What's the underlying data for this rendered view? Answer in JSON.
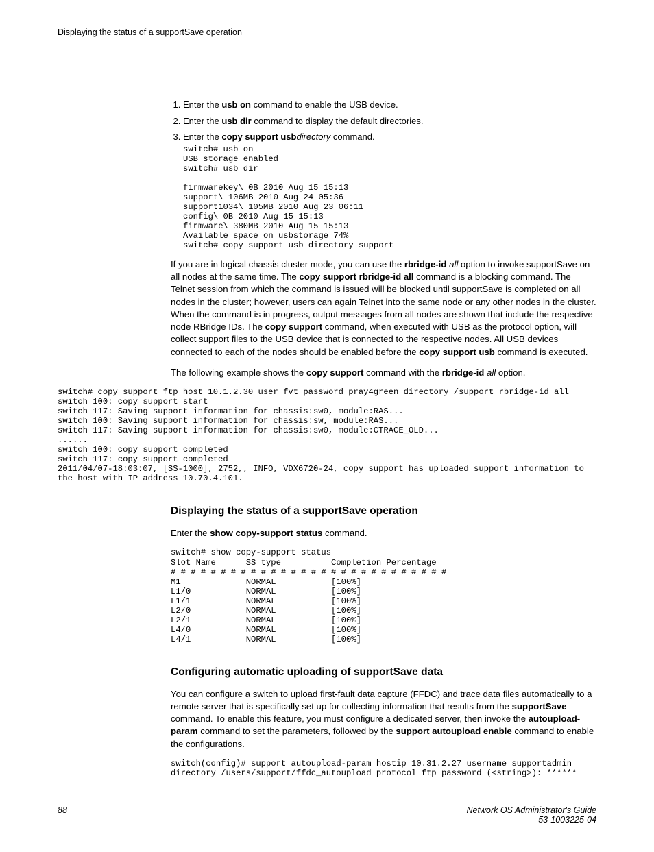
{
  "header": "Displaying the status of a supportSave operation",
  "steps": {
    "s1_pre": "Enter the ",
    "s1_cmd": "usb on",
    "s1_post": " command to enable the USB device.",
    "s2_pre": "Enter the ",
    "s2_cmd": "usb dir",
    "s2_post": " command to display the default directories.",
    "s3_pre": "Enter the ",
    "s3_cmd": "copy support usb",
    "s3_arg": "directory",
    "s3_post": " command."
  },
  "code1": "switch# usb on\nUSB storage enabled\nswitch# usb dir\n\nfirmwarekey\\ 0B 2010 Aug 15 15:13\nsupport\\ 106MB 2010 Aug 24 05:36\nsupport1034\\ 105MB 2010 Aug 23 06:11\nconfig\\ 0B 2010 Aug 15 15:13\nfirmware\\ 380MB 2010 Aug 15 15:13\nAvailable space on usbstorage 74%\nswitch# copy support usb directory support",
  "para1": {
    "p1": "If you are in logical chassis cluster mode, you can use the ",
    "b1": "rbridge-id",
    "i1": " all",
    "p2": " option to invoke supportSave on all nodes at the same time. The ",
    "b2": "copy support rbridge-id all",
    "p3": " command is a blocking command. The Telnet session from which the command is issued will be blocked until supportSave is completed on all nodes in the cluster; however, users can again Telnet into the same node or any other nodes in the cluster. When the command is in progress, output messages from all nodes are shown that include the respective node RBridge IDs. The ",
    "b3": "copy support",
    "p4": " command, when executed with USB as the protocol option, will collect support files to the USB device that is connected to the respective nodes. All USB devices connected to each of the nodes should be enabled before the ",
    "b4": "copy support usb",
    "p5": " command is executed."
  },
  "para2": {
    "p1": "The following example shows the ",
    "b1": "copy support",
    "p2": " command with the ",
    "b2": "rbridge-id",
    "i1": " all",
    "p3": " option."
  },
  "code2": "switch# copy support ftp host 10.1.2.30 user fvt password pray4green directory /support rbridge-id all\nswitch 100: copy support start\nswitch 117: Saving support information for chassis:sw0, module:RAS...\nswitch 100: Saving support information for chassis:sw, module:RAS...\nswitch 117: Saving support information for chassis:sw0, module:CTRACE_OLD...\n......\nswitch 100: copy support completed\nswitch 117: copy support completed\n2011/04/07-18:03:07, [SS-1000], 2752,, INFO, VDX6720-24, copy support has uploaded support information to the host with IP address 10.70.4.101.",
  "section1": {
    "title": "Displaying the status of a supportSave operation",
    "intro_pre": "Enter the ",
    "intro_cmd": "show copy-support status",
    "intro_post": " command."
  },
  "code3": "switch# show copy-support status\nSlot Name      SS type          Completion Percentage\n# # # # # # # # # # # # # # # # # # # # # # # # # # # #\nM1             NORMAL           [100%]\nL1/0           NORMAL           [100%]\nL1/1           NORMAL           [100%]\nL2/0           NORMAL           [100%]\nL2/1           NORMAL           [100%]\nL4/0           NORMAL           [100%]\nL4/1           NORMAL           [100%]",
  "section2": {
    "title": "Configuring automatic uploading of supportSave data",
    "p1": "You can configure a switch to upload first-fault data capture (FFDC) and trace data files automatically to a remote server that is specifically set up for collecting information that results from the ",
    "b1": "supportSave",
    "p2": " command. To enable this feature, you must configure a dedicated server, then invoke the ",
    "b2": "autoupload-param",
    "p3": " command to set the parameters, followed by the ",
    "b3": "support autoupload enable",
    "p4": " command to enable the configurations."
  },
  "code4": "switch(config)# support autoupload-param hostip 10.31.2.27 username supportadmin directory /users/support/ffdc_autoupload protocol ftp password (<string>): ******",
  "footer": {
    "page": "88",
    "title": "Network OS Administrator's Guide",
    "docid": "53-1003225-04"
  }
}
